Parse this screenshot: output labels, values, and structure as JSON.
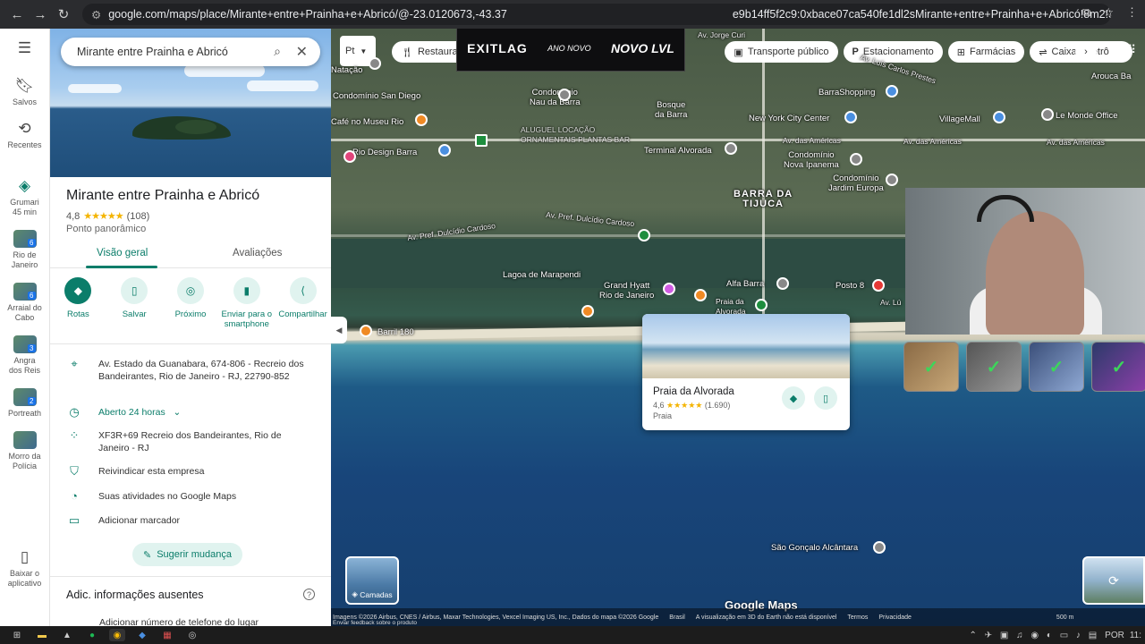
{
  "browser": {
    "url": "google.com/maps/place/Mirante+entre+Prainha+e+Abricó/@-23.0120673,-43.37",
    "url_tail": "e9b14ff5f2c9:0xbace07ca540fe1dl2sMirante+entre+Prainha+e+Abricó!8m2!3d-23.04..."
  },
  "rail": {
    "items": [
      {
        "label": "Salvos",
        "icon": "bookmark-icon"
      },
      {
        "label": "Recentes",
        "icon": "history-icon"
      },
      {
        "label": "Grumari\n45 min",
        "icon": "directions-icon"
      },
      {
        "label": "Rio de\nJaneiro",
        "badge": "6"
      },
      {
        "label": "Arraial do\nCabo",
        "badge": "6"
      },
      {
        "label": "Angra\ndos Reis",
        "badge": "3"
      },
      {
        "label": "Portreath",
        "badge": "2"
      },
      {
        "label": "Morro da\nPolícia",
        "badge": ""
      },
      {
        "label": "Baixar o\naplicativo",
        "icon": "phone-icon"
      }
    ]
  },
  "panel": {
    "search_value": "Mirante entre Prainha e Abricó",
    "title": "Mirante entre Prainha e Abricó",
    "rating": "4,8",
    "stars": "★★★★★",
    "reviews": "(108)",
    "category": "Ponto panorâmico",
    "tabs": [
      "Visão geral",
      "Avaliações"
    ],
    "actions": [
      "Rotas",
      "Salvar",
      "Próximo",
      "Enviar para o smartphone",
      "Compartilhar"
    ],
    "address": "Av. Estado da Guanabara, 674-806 - Recreio dos Bandeirantes, Rio de Janeiro - RJ, 22790-852",
    "hours": "Aberto 24 horas",
    "plus_code": "XF3R+69 Recreio dos Bandeirantes, Rio de Janeiro - RJ",
    "claim": "Reivindicar esta empresa",
    "activity": "Suas atividades no Google Maps",
    "label": "Adicionar marcador",
    "suggest": "Sugerir mudança",
    "add_title": "Adic. informações ausentes",
    "add_phone": "Adicionar número de telefone do lugar"
  },
  "map": {
    "pt_label": "Pt",
    "chips": [
      "Restaurantes",
      "Transporte público",
      "Estacionamento",
      "Farmácias",
      "Caixas eletrô"
    ],
    "banner": {
      "brand": "EXITLAG",
      "sub": "ANO NOVO",
      "tag": "NOVO LVL"
    },
    "labels": {
      "jorge_curi": "Av. Jorge Curi",
      "carlos_prestes": "Av. Luís Carlos Prestes",
      "nautico": "Natação",
      "sandiego": "Condomínio San Diego",
      "naudabarra": "Condomínio\nNau da Barra",
      "bosque": "Bosque\nda Barra",
      "barrashopping": "BarraShopping",
      "aroucaba": "Arouca Ba",
      "cafemuseu": "Café no Museu Rio",
      "newyork": "New York City Center",
      "villagemall": "VillageMall",
      "lemonde": "Le Monde Office",
      "aluguel": "ALUGUEL LOCAÇÃO\nORNAMENTAIS PLANTAS BAR",
      "americas": "Av. das Américas",
      "americas2": "Av. das Américas",
      "americas3": "Av. das Américas",
      "riodesign": "Rio Design Barra",
      "terminal": "Terminal Alvorada",
      "novaipanema": "Condomínio\nNova Ipanema",
      "jardimeuropa": "Condomínio\nJardim Europa",
      "barradatijuca": "BARRA DA\nTIJUCA",
      "dulcidio": "Av. Pref. Dulcídio Cardoso",
      "dulcidio2": "Av. Pref. Dulcídio Cardoso",
      "marapendi": "Lagoa de Marapendi",
      "grandhyatt": "Grand Hyatt\nRio de Janeiro",
      "alfabarra": "Alfa Barra",
      "posto8": "Posto 8",
      "alvorada_small": "Praia da\nAlvorada",
      "barril": "Barril 180",
      "saogoncalo": "São Gonçalo Alcântara",
      "av_lu": "Av. Lú"
    },
    "card": {
      "name": "Praia da Alvorada",
      "rating": "4,6",
      "stars": "★★★★★",
      "reviews": "(1.690)",
      "category": "Praia"
    },
    "layers": "Camadas",
    "google_maps": "Google Maps",
    "attribution": [
      "Imagens ©2026 Airbus, CNES / Airbus, Maxar Technologies, Vexcel Imaging US, Inc., Dados do mapa ©2026 Google",
      "Brasil",
      "A visualização em 3D do Earth não está disponível",
      "Termos",
      "Privacidade",
      "500 m"
    ],
    "feedback": "Enviar feedback sobre o produto"
  },
  "taskbar": {
    "lang": "POR",
    "time": "11:"
  }
}
